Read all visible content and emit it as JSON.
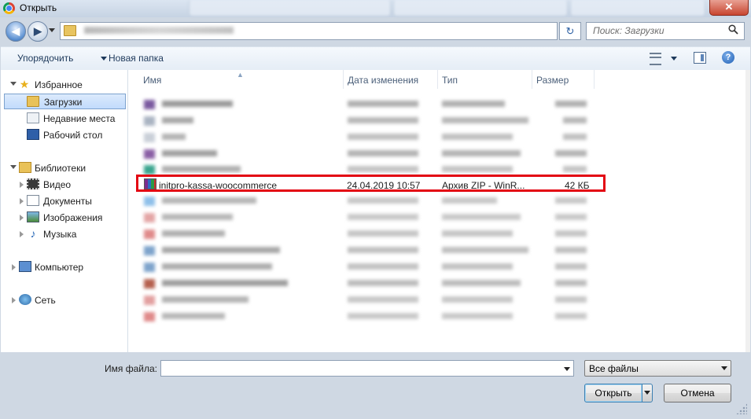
{
  "window": {
    "title": "Открыть",
    "close_glyph": "✕"
  },
  "address": {
    "back_glyph": "◀",
    "forward_glyph": "▶",
    "refresh_glyph": "↻"
  },
  "search": {
    "placeholder": "Поиск: Загрузки",
    "icon": "search-icon"
  },
  "toolbar": {
    "organize_label": "Упорядочить",
    "new_folder_label": "Новая папка",
    "help_glyph": "?"
  },
  "sidebar": {
    "favorites": {
      "label": "Избранное",
      "items": [
        {
          "label": "Загрузки",
          "icon": "downloads-folder-icon",
          "selected": true
        },
        {
          "label": "Недавние места",
          "icon": "recent-places-icon"
        },
        {
          "label": "Рабочий стол",
          "icon": "desktop-icon"
        }
      ]
    },
    "libraries": {
      "label": "Библиотеки",
      "items": [
        {
          "label": "Видео",
          "icon": "video-library-icon"
        },
        {
          "label": "Документы",
          "icon": "documents-library-icon"
        },
        {
          "label": "Изображения",
          "icon": "pictures-library-icon"
        },
        {
          "label": "Музыка",
          "icon": "music-library-icon"
        }
      ]
    },
    "computer": {
      "label": "Компьютер",
      "icon": "computer-icon"
    },
    "network": {
      "label": "Сеть",
      "icon": "network-icon"
    }
  },
  "columns": {
    "name": "Имя",
    "date": "Дата изменения",
    "type": "Тип",
    "size": "Размер"
  },
  "selected_file": {
    "name": "initpro-kassa-woocommerce",
    "date": "24.04.2019 10:57",
    "type": "Архив ZIP - WinR...",
    "size": "42 КБ",
    "icon": "winrar-archive-icon"
  },
  "bottom": {
    "filename_label": "Имя файла:",
    "filename_value": "",
    "filter_value": "Все файлы",
    "open_label": "Открыть",
    "cancel_label": "Отмена"
  },
  "colors": {
    "highlight_box": "#e30613",
    "titlebar": "#c6d3e3"
  }
}
